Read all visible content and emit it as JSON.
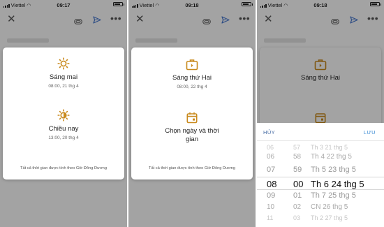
{
  "panels": [
    {
      "status": {
        "carrier": "Viettel",
        "time": "09:17"
      },
      "dialog": {
        "options": [
          {
            "icon": "sun-icon",
            "title": "Sáng mai",
            "subtitle": "08:00, 21 thg 4"
          },
          {
            "icon": "afternoon-sun-icon",
            "title": "Chiều nay",
            "subtitle": "13:00, 20 thg 4"
          }
        ],
        "footnote": "Tất cả thời gian được tính theo Giờ Đông Dương"
      }
    },
    {
      "status": {
        "carrier": "Viettel",
        "time": "09:18"
      },
      "dialog": {
        "options": [
          {
            "icon": "briefcase-icon",
            "title": "Sáng thứ Hai",
            "subtitle": "08:00, 22 thg 4"
          },
          {
            "icon": "calendar-icon",
            "title": "Chọn ngày và thời gian",
            "subtitle": ""
          }
        ],
        "footnote": "Tất cả thời gian được tính theo Giờ Đông Dương"
      }
    },
    {
      "status": {
        "carrier": "Viettel",
        "time": "09:18"
      },
      "dialog": {
        "options": [
          {
            "icon": "briefcase-icon",
            "title": "Sáng thứ Hai"
          }
        ]
      },
      "sheet": {
        "cancel_label": "HỦY",
        "save_label": "LƯU",
        "picker_rows": [
          {
            "hour": "06",
            "minute": "57",
            "date": "Th 3 21 thg 5"
          },
          {
            "hour": "06",
            "minute": "58",
            "date": "Th 4 22 thg 5"
          },
          {
            "hour": "07",
            "minute": "59",
            "date": "Th 5 23 thg 5"
          },
          {
            "hour": "08",
            "minute": "00",
            "date": "Th 6 24 thg 5"
          },
          {
            "hour": "09",
            "minute": "01",
            "date": "Th 7 25 thg 5"
          },
          {
            "hour": "10",
            "minute": "02",
            "date": "CN 26 thg 5"
          },
          {
            "hour": "11",
            "minute": "03",
            "date": "Th 2 27 thg 5"
          }
        ],
        "selected_index": 3
      }
    }
  ],
  "colors": {
    "accent_icon": "#c98a1d",
    "send": "#4a7bd0",
    "link": "#3b8bd4"
  }
}
